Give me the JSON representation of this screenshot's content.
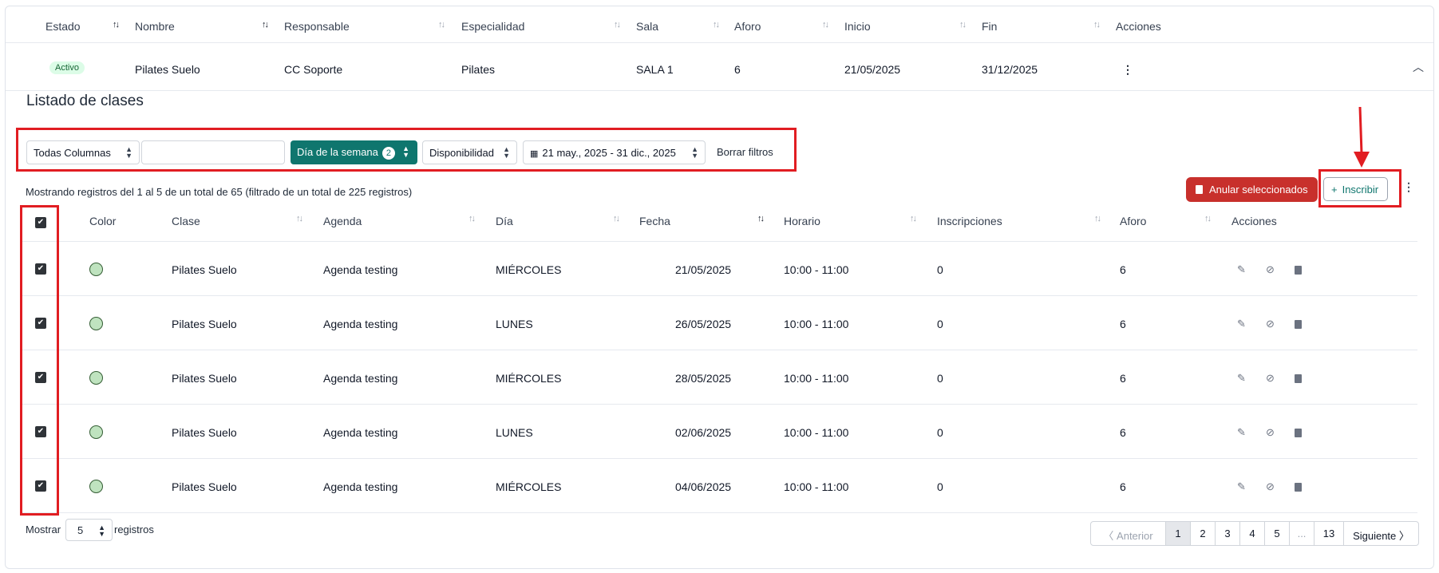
{
  "outer_table": {
    "headers": [
      "Estado",
      "Nombre",
      "Responsable",
      "Especialidad",
      "Sala",
      "Aforo",
      "Inicio",
      "Fin",
      "Acciones"
    ],
    "row": {
      "status": "Activo",
      "name": "Pilates Suelo",
      "responsible": "CC Soporte",
      "specialty": "Pilates",
      "room": "SALA 1",
      "capacity": "6",
      "start": "21/05/2025",
      "end": "31/12/2025"
    }
  },
  "section": {
    "title": "Listado de clases"
  },
  "filters": {
    "columns_select": "Todas Columnas",
    "search_value": "",
    "weekday_label": "Día de la semana",
    "weekday_count": "2",
    "availability_label": "Disponibilidad",
    "date_range": "21 may., 2025 - 31 dic., 2025",
    "clear_label": "Borrar filtros"
  },
  "summary": "Mostrando registros del 1 al 5 de un total de 65 (filtrado de un total de 225 registros)",
  "toolbar": {
    "cancel_selected_label": "Anular seleccionados",
    "enroll_label": "Inscribir"
  },
  "inner_table": {
    "headers": [
      "Color",
      "Clase",
      "Agenda",
      "Día",
      "Fecha",
      "Horario",
      "Inscripciones",
      "Aforo",
      "Acciones"
    ],
    "rows": [
      {
        "class": "Pilates Suelo",
        "agenda": "Agenda testing",
        "day": "MIÉRCOLES",
        "date": "21/05/2025",
        "time": "10:00 - 11:00",
        "enrollments": "0",
        "capacity": "6"
      },
      {
        "class": "Pilates Suelo",
        "agenda": "Agenda testing",
        "day": "LUNES",
        "date": "26/05/2025",
        "time": "10:00 - 11:00",
        "enrollments": "0",
        "capacity": "6"
      },
      {
        "class": "Pilates Suelo",
        "agenda": "Agenda testing",
        "day": "MIÉRCOLES",
        "date": "28/05/2025",
        "time": "10:00 - 11:00",
        "enrollments": "0",
        "capacity": "6"
      },
      {
        "class": "Pilates Suelo",
        "agenda": "Agenda testing",
        "day": "LUNES",
        "date": "02/06/2025",
        "time": "10:00 - 11:00",
        "enrollments": "0",
        "capacity": "6"
      },
      {
        "class": "Pilates Suelo",
        "agenda": "Agenda testing",
        "day": "MIÉRCOLES",
        "date": "04/06/2025",
        "time": "10:00 - 11:00",
        "enrollments": "0",
        "capacity": "6"
      }
    ]
  },
  "footer": {
    "show_label": "Mostrar",
    "page_size": "5",
    "records_label": "registros",
    "pagination": {
      "prev": "Anterior",
      "pages": [
        "1",
        "2",
        "3",
        "4",
        "5"
      ],
      "ellipsis": "...",
      "last": "13",
      "next": "Siguiente",
      "current": "1"
    }
  },
  "colors": {
    "accent": "#0f766e",
    "danger": "#c8302c",
    "annotation": "#e11d22",
    "status_badge_bg": "#dcfce7",
    "class_color_dot": "#bfe3bf"
  }
}
